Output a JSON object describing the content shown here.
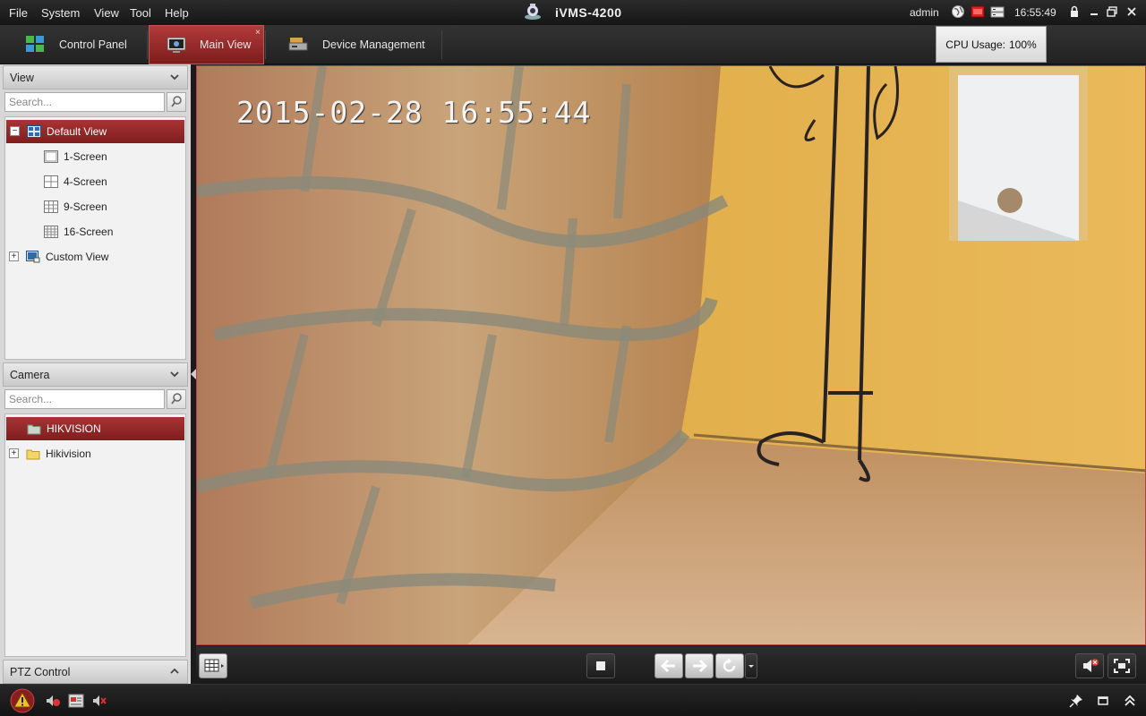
{
  "menu": {
    "items": [
      "File",
      "System",
      "View",
      "Tool",
      "Help"
    ]
  },
  "app": {
    "title": "iVMS-4200"
  },
  "topbar": {
    "user": "admin",
    "clock": "16:55:49",
    "icons": [
      "globe-icon",
      "alarm-record-icon",
      "hdd-icon",
      "lock-icon",
      "minimize-icon",
      "restore-icon",
      "close-icon"
    ]
  },
  "tabs": [
    {
      "label": "Control Panel",
      "icon": "control-panel-icon",
      "active": false
    },
    {
      "label": "Main View",
      "icon": "main-view-icon",
      "active": true
    },
    {
      "label": "Device Management",
      "icon": "device-management-icon",
      "active": false
    }
  ],
  "cpu": {
    "label": "CPU Usage:",
    "value": "100%"
  },
  "view_panel": {
    "title": "View",
    "search_placeholder": "Search...",
    "tree": [
      {
        "label": "Default View",
        "selected": true,
        "expanded": true
      },
      {
        "label": "1-Screen"
      },
      {
        "label": "4-Screen"
      },
      {
        "label": "9-Screen"
      },
      {
        "label": "16-Screen"
      },
      {
        "label": "Custom View",
        "expanded": false
      }
    ]
  },
  "camera_panel": {
    "title": "Camera",
    "search_placeholder": "Search...",
    "tree": [
      {
        "label": "HIKVISION",
        "selected": true
      },
      {
        "label": "Hikivision",
        "expanded": false
      }
    ]
  },
  "ptz_panel": {
    "title": "PTZ Control"
  },
  "video": {
    "osd_timestamp": "2015-02-28  16:55:44"
  },
  "controls": {
    "icons": [
      "layout-grid-icon",
      "stop-all-icon",
      "previous-icon",
      "next-icon",
      "auto-switch-icon",
      "dropdown-icon",
      "mute-icon",
      "fullscreen-icon"
    ]
  },
  "status": {
    "icons": [
      "alarm-warning-icon",
      "alarm-sound-icon",
      "event-icon",
      "audio-off-icon",
      "pin-icon",
      "window-icon",
      "expand-up-icon"
    ]
  },
  "colors": {
    "accent_red": "#9e2a2a",
    "selection_red": "#a83434"
  }
}
